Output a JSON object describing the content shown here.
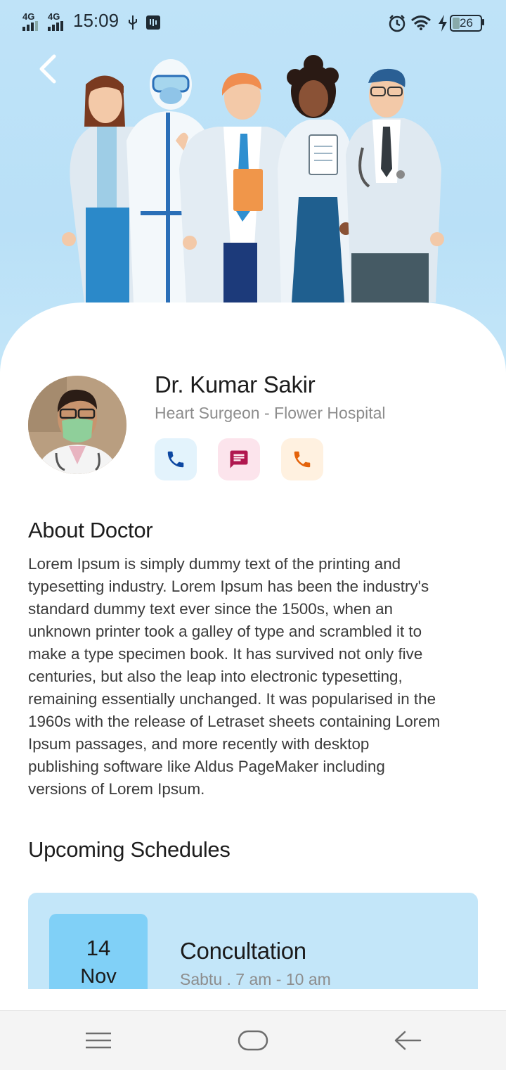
{
  "status_bar": {
    "network_1": "4G",
    "network_2": "4G",
    "time": "15:09",
    "battery": "26",
    "icons": [
      "signal-icon",
      "usb-icon",
      "sd-card-icon",
      "alarm-icon",
      "wifi-icon",
      "charging-icon",
      "battery-icon"
    ]
  },
  "header": {
    "back_icon": "chevron-left-icon",
    "illustration": "medical-team-illustration"
  },
  "doctor": {
    "name": "Dr. Kumar Sakir",
    "subtitle": "Heart Surgeon - Flower Hospital",
    "actions": [
      {
        "icon": "phone-icon",
        "color": "#0d47a1",
        "bg": "#e3f3fc"
      },
      {
        "icon": "message-icon",
        "color": "#b0174f",
        "bg": "#fce4ec"
      },
      {
        "icon": "phone-icon",
        "color": "#e4620a",
        "bg": "#fff1e0"
      }
    ]
  },
  "about": {
    "title": "About Doctor",
    "lines": [
      "Lorem Ipsum is simply dummy text of the printing and",
      "typesetting industry. Lorem Ipsum has been the industry's",
      "standard dummy text ever since the 1500s, when an",
      "unknown printer took a galley of type and scrambled it to",
      "make a type specimen book. It has survived not only five",
      "centuries, but also the leap into electronic typesetting,",
      "remaining essentially unchanged. It was popularised in the",
      "1960s with the release of Letraset sheets containing Lorem",
      "Ipsum passages, and more recently with desktop",
      "publishing software like Aldus PageMaker including",
      "versions of Lorem Ipsum."
    ]
  },
  "schedules": {
    "title": "Upcoming Schedules",
    "items": [
      {
        "day": "14",
        "month": "Nov",
        "title": "Concultation",
        "time": "Sabtu . 7 am - 10 am"
      }
    ]
  },
  "nav_bar": {
    "icons": [
      "menu-icon",
      "home-icon",
      "back-arrow-icon"
    ]
  },
  "colors": {
    "hero_bg": "#bfe3f8",
    "card_bg": "#c3e6f9",
    "date_bg": "#80d0f7"
  }
}
